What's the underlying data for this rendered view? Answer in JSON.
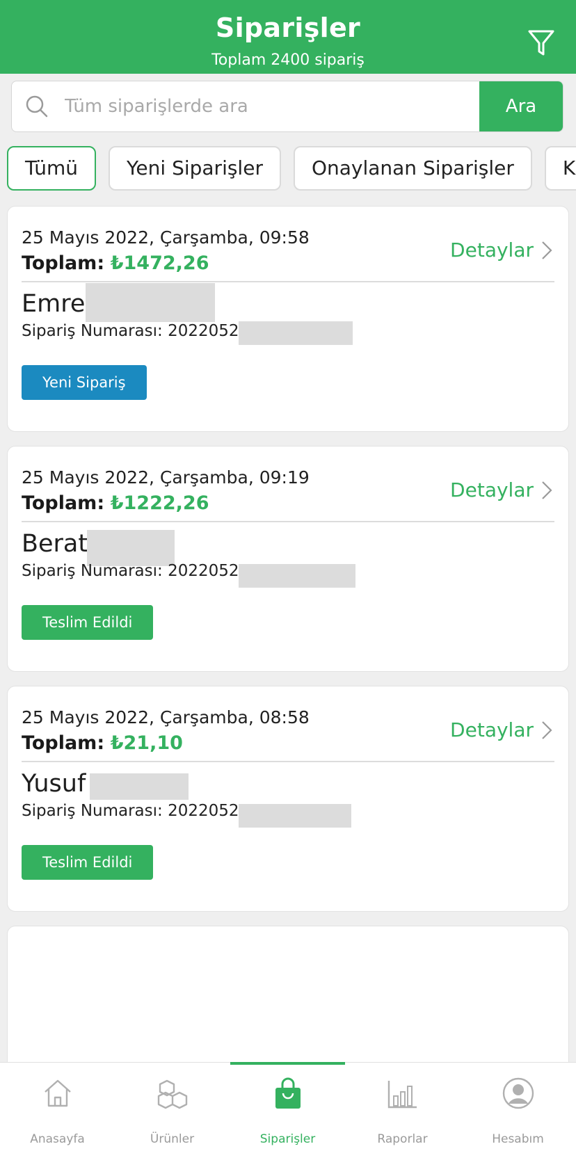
{
  "header": {
    "title": "Siparişler",
    "subtitle": "Toplam 2400 sipariş"
  },
  "search": {
    "placeholder": "Tüm siparişlerde ara",
    "button_label": "Ara"
  },
  "tabs": [
    {
      "label": "Tümü",
      "active": true
    },
    {
      "label": "Yeni Siparişler",
      "active": false
    },
    {
      "label": "Onaylanan Siparişler",
      "active": false
    },
    {
      "label": "Kar",
      "active": false
    }
  ],
  "orders": [
    {
      "date": "25 Mayıs 2022, Çarşamba, 09:58",
      "total_label": "Toplam:",
      "total_amount": "₺1472,26",
      "details_label": "Detaylar",
      "name": "Emre",
      "order_no_label": "Sipariş Numarası: 20220525",
      "status": "Yeni Sipariş",
      "status_color": "#1b8ac0"
    },
    {
      "date": "25 Mayıs 2022, Çarşamba, 09:19",
      "total_label": "Toplam:",
      "total_amount": "₺1222,26",
      "details_label": "Detaylar",
      "name": "Berat",
      "order_no_label": "Sipariş Numarası: 20220525",
      "status": "Teslim Edildi",
      "status_color": "#34b15f"
    },
    {
      "date": "25 Mayıs 2022, Çarşamba, 08:58",
      "total_label": "Toplam:",
      "total_amount": "₺21,10",
      "details_label": "Detaylar",
      "name": "Yusuf",
      "order_no_label": "Sipariş Numarası: 20220525",
      "status": "Teslim Edildi",
      "status_color": "#34b15f"
    }
  ],
  "bottom_nav": [
    {
      "label": "Anasayfa",
      "icon": "home-icon",
      "active": false
    },
    {
      "label": "Ürünler",
      "icon": "boxes-icon",
      "active": false
    },
    {
      "label": "Siparişler",
      "icon": "shopping-bag-icon",
      "active": true
    },
    {
      "label": "Raporlar",
      "icon": "bar-chart-icon",
      "active": false
    },
    {
      "label": "Hesabım",
      "icon": "user-icon",
      "active": false
    }
  ],
  "colors": {
    "primary": "#34b15f",
    "blue_status": "#1b8ac0",
    "background": "#efefef"
  }
}
